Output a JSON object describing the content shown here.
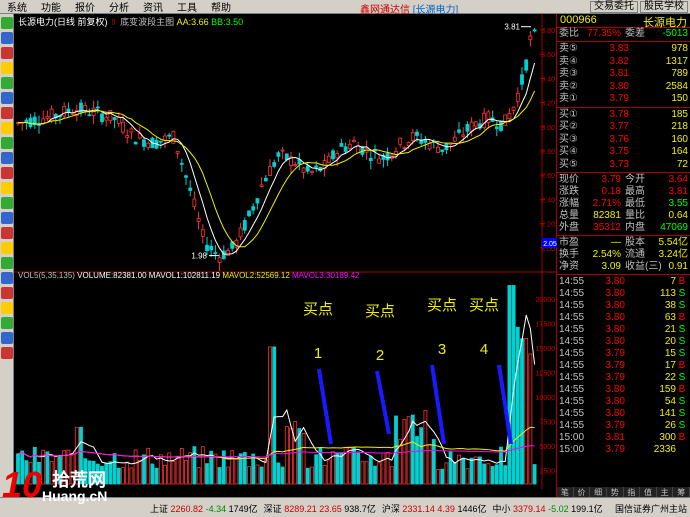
{
  "menu": {
    "items": [
      "系统",
      "功能",
      "报价",
      "分析",
      "资讯",
      "工具",
      "帮助"
    ],
    "title": "鑫网通达信",
    "subtitle": "[长源电力]",
    "right_buttons": [
      "交易委托",
      "股民学校"
    ]
  },
  "kline": {
    "title": "长源电力(日线 前复权)",
    "indicator": "底变波段主图",
    "aa": "AA:3.66",
    "bb": "BB:3.50",
    "high_label": "3.81",
    "low_label": "1.98",
    "price_ticks": [
      "3.80",
      "3.60",
      "3.40",
      "3.20",
      "3.00",
      "2.80",
      "2.60",
      "2.40",
      "2.20",
      "2.00"
    ],
    "last_price_box": "2.05"
  },
  "volume": {
    "title": "VOL5(5,35,135)",
    "vol": "VOLUME:82381.00",
    "mavol1": "MAVOL1:102811.19",
    "mavol2": "MAVOL2:52569.12",
    "mavol3": "MAVOL3:30189.42",
    "ticks": [
      "20000",
      "17500",
      "15000",
      "12500",
      "10000",
      "7500",
      "5000",
      "2500"
    ],
    "buy_points": [
      {
        "label": "买点",
        "num": "1"
      },
      {
        "label": "买点",
        "num": "2"
      },
      {
        "label": "买点",
        "num": "3"
      },
      {
        "label": "买点",
        "num": "4"
      }
    ],
    "x_labels": [
      "1",
      "2",
      "3"
    ]
  },
  "quote": {
    "code": "000966",
    "name": "长源电力",
    "webi_label": "委比",
    "webi": "77.35%",
    "weicha_label": "委差",
    "weicha": "-5013",
    "sells": [
      {
        "label": "卖⑤",
        "price": "3.83",
        "vol": "978"
      },
      {
        "label": "卖④",
        "price": "3.82",
        "vol": "1317"
      },
      {
        "label": "卖③",
        "price": "3.81",
        "vol": "789"
      },
      {
        "label": "卖②",
        "price": "3.80",
        "vol": "2584"
      },
      {
        "label": "卖①",
        "price": "3.79",
        "vol": "150"
      }
    ],
    "buys": [
      {
        "label": "买①",
        "price": "3.78",
        "vol": "185"
      },
      {
        "label": "买②",
        "price": "3.77",
        "vol": "218"
      },
      {
        "label": "买③",
        "price": "3.76",
        "vol": "160"
      },
      {
        "label": "买④",
        "price": "3.75",
        "vol": "164"
      },
      {
        "label": "买⑤",
        "price": "3.73",
        "vol": "72"
      }
    ],
    "stats": [
      {
        "l": "现价",
        "v": "3.79",
        "l2": "今开",
        "v2": "3.64"
      },
      {
        "l": "涨跌",
        "v": "0.18",
        "l2": "最高",
        "v2": "3.81"
      },
      {
        "l": "涨幅",
        "v": "2.71%",
        "l2": "最低",
        "v2": "3.55"
      },
      {
        "l": "总量",
        "v": "82381",
        "l2": "量比",
        "v2": "0.64"
      },
      {
        "l": "外盘",
        "v": "35312",
        "l2": "内盘",
        "v2": "47069"
      }
    ],
    "stats2": [
      {
        "l": "市盈",
        "v": "—",
        "l2": "股本",
        "v2": "5.54亿"
      },
      {
        "l": "换手",
        "v": "2.54%",
        "l2": "流通",
        "v2": "3.24亿"
      },
      {
        "l": "净资",
        "v": "3.09",
        "l2": "收益(三)",
        "v2": "0.91"
      }
    ],
    "ticks": [
      {
        "t": "14:55",
        "p": "3.80",
        "n": "7",
        "d": "B"
      },
      {
        "t": "14:55",
        "p": "3.80",
        "n": "113",
        "d": "S"
      },
      {
        "t": "14:55",
        "p": "3.80",
        "n": "38",
        "d": "S"
      },
      {
        "t": "14:55",
        "p": "3.80",
        "n": "63",
        "d": "B"
      },
      {
        "t": "14:55",
        "p": "3.80",
        "n": "21",
        "d": "S"
      },
      {
        "t": "14:55",
        "p": "3.80",
        "n": "20",
        "d": "S"
      },
      {
        "t": "14:55",
        "p": "3.79",
        "n": "15",
        "d": "S"
      },
      {
        "t": "14:55",
        "p": "3.79",
        "n": "17",
        "d": "B"
      },
      {
        "t": "14:55",
        "p": "3.79",
        "n": "22",
        "d": "S"
      },
      {
        "t": "14:55",
        "p": "3.80",
        "n": "159",
        "d": "B"
      },
      {
        "t": "14:55",
        "p": "3.80",
        "n": "54",
        "d": "S"
      },
      {
        "t": "14:55",
        "p": "3.80",
        "n": "141",
        "d": "S"
      },
      {
        "t": "14:55",
        "p": "3.79",
        "n": "26",
        "d": "S"
      },
      {
        "t": "15:00",
        "p": "3.81",
        "n": "300",
        "d": "B"
      },
      {
        "t": "15:00",
        "p": "3.79",
        "n": "2336",
        "d": ""
      }
    ],
    "tabs": [
      "笔",
      "价",
      "细",
      "势",
      "指",
      "值",
      "主",
      "筹"
    ]
  },
  "status": {
    "sh_label": "上证",
    "sh_val": "2260.82",
    "sh_chg": "-4.34",
    "sh_vol": "1749亿",
    "sz_label": "深证",
    "sz_val": "8289.21",
    "sz_chg": "23.65",
    "sz_vol": "938.7亿",
    "hs_label": "沪深",
    "hs_val": "2331.14",
    "hs_chg": "4.39",
    "hs_vol": "1446亿",
    "zx_label": "中小",
    "zx_val": "3379.14",
    "zx_chg": "-5.02",
    "zx_vol": "199.1亿",
    "broker": "国信证券广州主站"
  },
  "logo": {
    "big": "10",
    "cn": "拾荒网",
    "en": "Huang.cN"
  },
  "colors": {
    "up": "#ff3333",
    "down": "#00d0d0",
    "ma1": "#ffffff",
    "ma2": "#f0f000",
    "ma3": "#ff00ff",
    "annot": "#f0f000",
    "arrow": "#1a1aff"
  }
}
